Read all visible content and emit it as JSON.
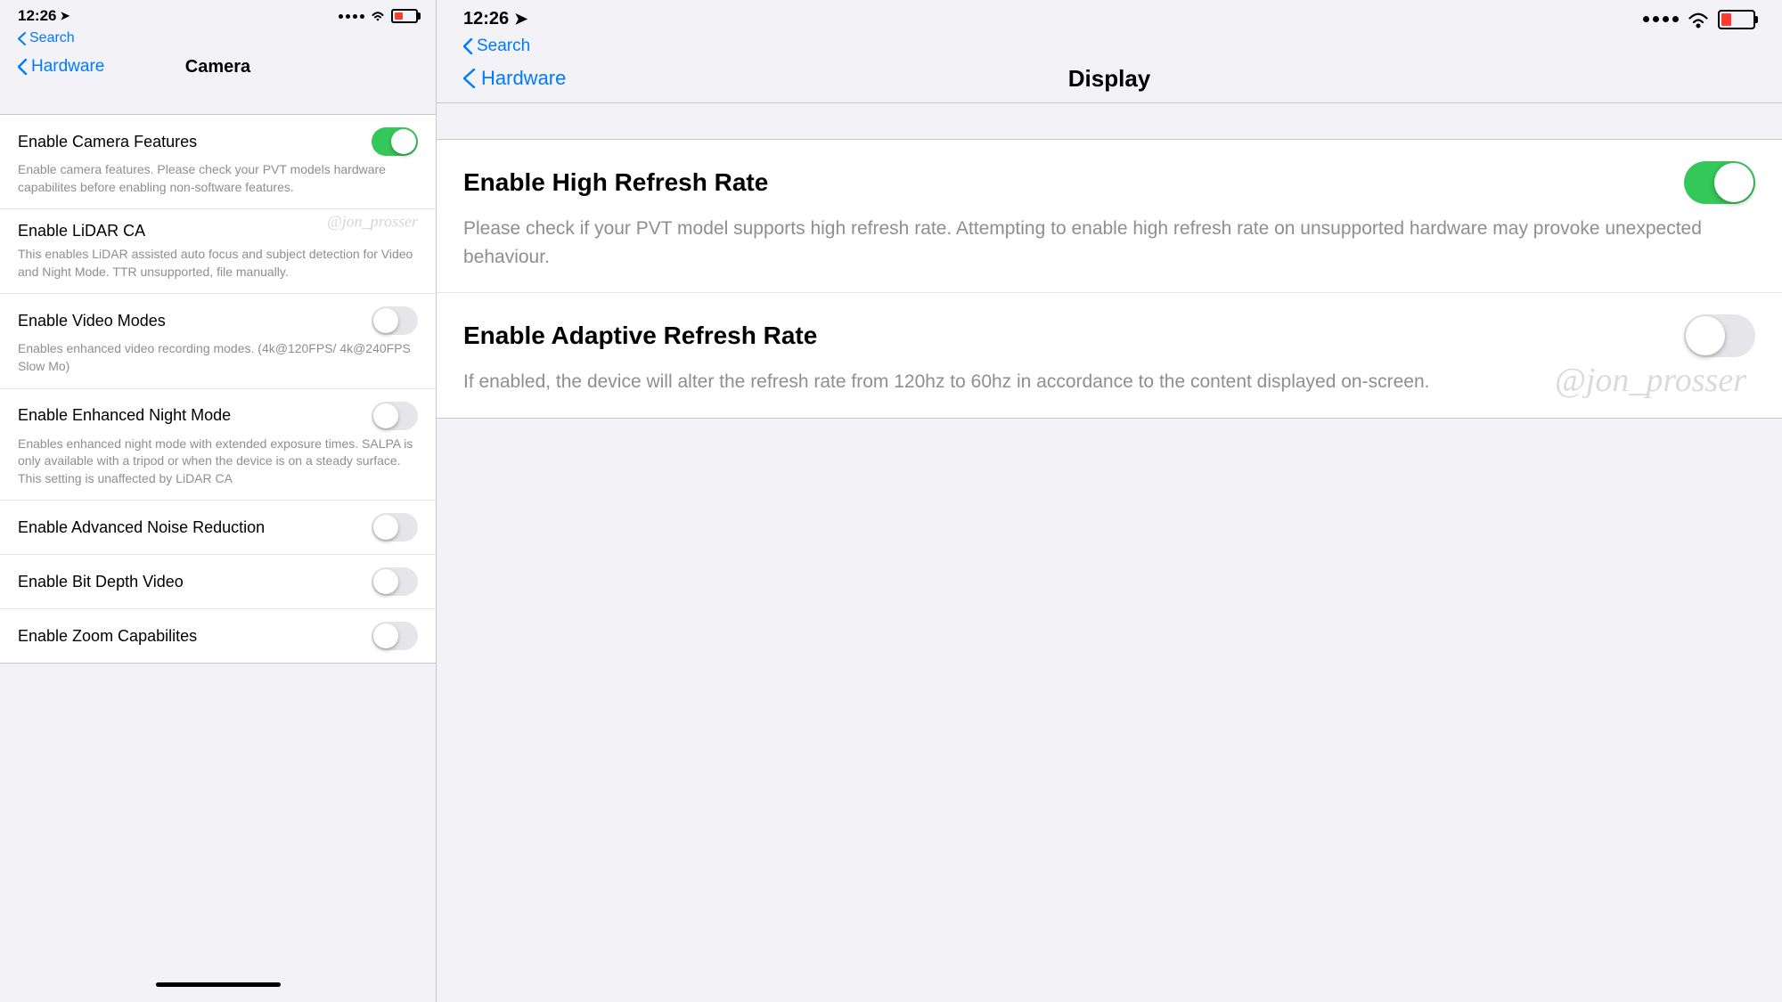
{
  "left": {
    "time": "12:26",
    "back_label": "Search",
    "nav_back_label": "Hardware",
    "nav_title": "Camera",
    "settings": [
      {
        "id": "enable-camera-features",
        "label": "Enable Camera Features",
        "desc": "Enable camera features. Please check your PVT models hardware capabilites before enabling non-software features.",
        "toggle": "on",
        "watermark": null
      },
      {
        "id": "enable-lidar-ca",
        "label": "Enable LiDAR CA",
        "desc": "This enables LiDAR assisted auto focus and subject detection for Video and Night Mode. TTR unsupported, file manually.",
        "toggle": null,
        "watermark": "@jon_prosser"
      },
      {
        "id": "enable-video-modes",
        "label": "Enable Video Modes",
        "desc": "Enables enhanced video recording modes. (4k@120FPS/ 4k@240FPS Slow Mo)",
        "toggle": "off",
        "watermark": null
      },
      {
        "id": "enable-enhanced-night-mode",
        "label": "Enable Enhanced Night Mode",
        "desc": "Enables enhanced night mode with extended exposure times. SALPA is only available with a tripod or when the device is on a steady surface. This setting is unaffected by LiDAR CA",
        "toggle": "off",
        "watermark": null
      },
      {
        "id": "enable-advanced-noise-reduction",
        "label": "Enable Advanced Noise Reduction",
        "desc": null,
        "toggle": "off",
        "watermark": null
      },
      {
        "id": "enable-bit-depth-video",
        "label": "Enable Bit Depth Video",
        "desc": null,
        "toggle": "off",
        "watermark": null
      },
      {
        "id": "enable-zoom-capabilities",
        "label": "Enable Zoom Capabilites",
        "desc": null,
        "toggle": "off",
        "watermark": null
      }
    ]
  },
  "right": {
    "time": "12:26",
    "back_label": "Search",
    "nav_back_label": "Hardware",
    "nav_title": "Display",
    "settings": [
      {
        "id": "enable-high-refresh-rate",
        "label": "Enable High Refresh Rate",
        "desc": "Please check if your PVT model supports high refresh rate. Attempting to enable high refresh rate on unsupported hardware may provoke unexpected behaviour.",
        "toggle": "on",
        "watermark": null
      },
      {
        "id": "enable-adaptive-refresh-rate",
        "label": "Enable Adaptive Refresh Rate",
        "desc": "If enabled, the device will alter the refresh rate from 120hz to 60hz in accordance to the content displayed on-screen.",
        "toggle": "off",
        "watermark": "@jon_prosser"
      }
    ]
  }
}
